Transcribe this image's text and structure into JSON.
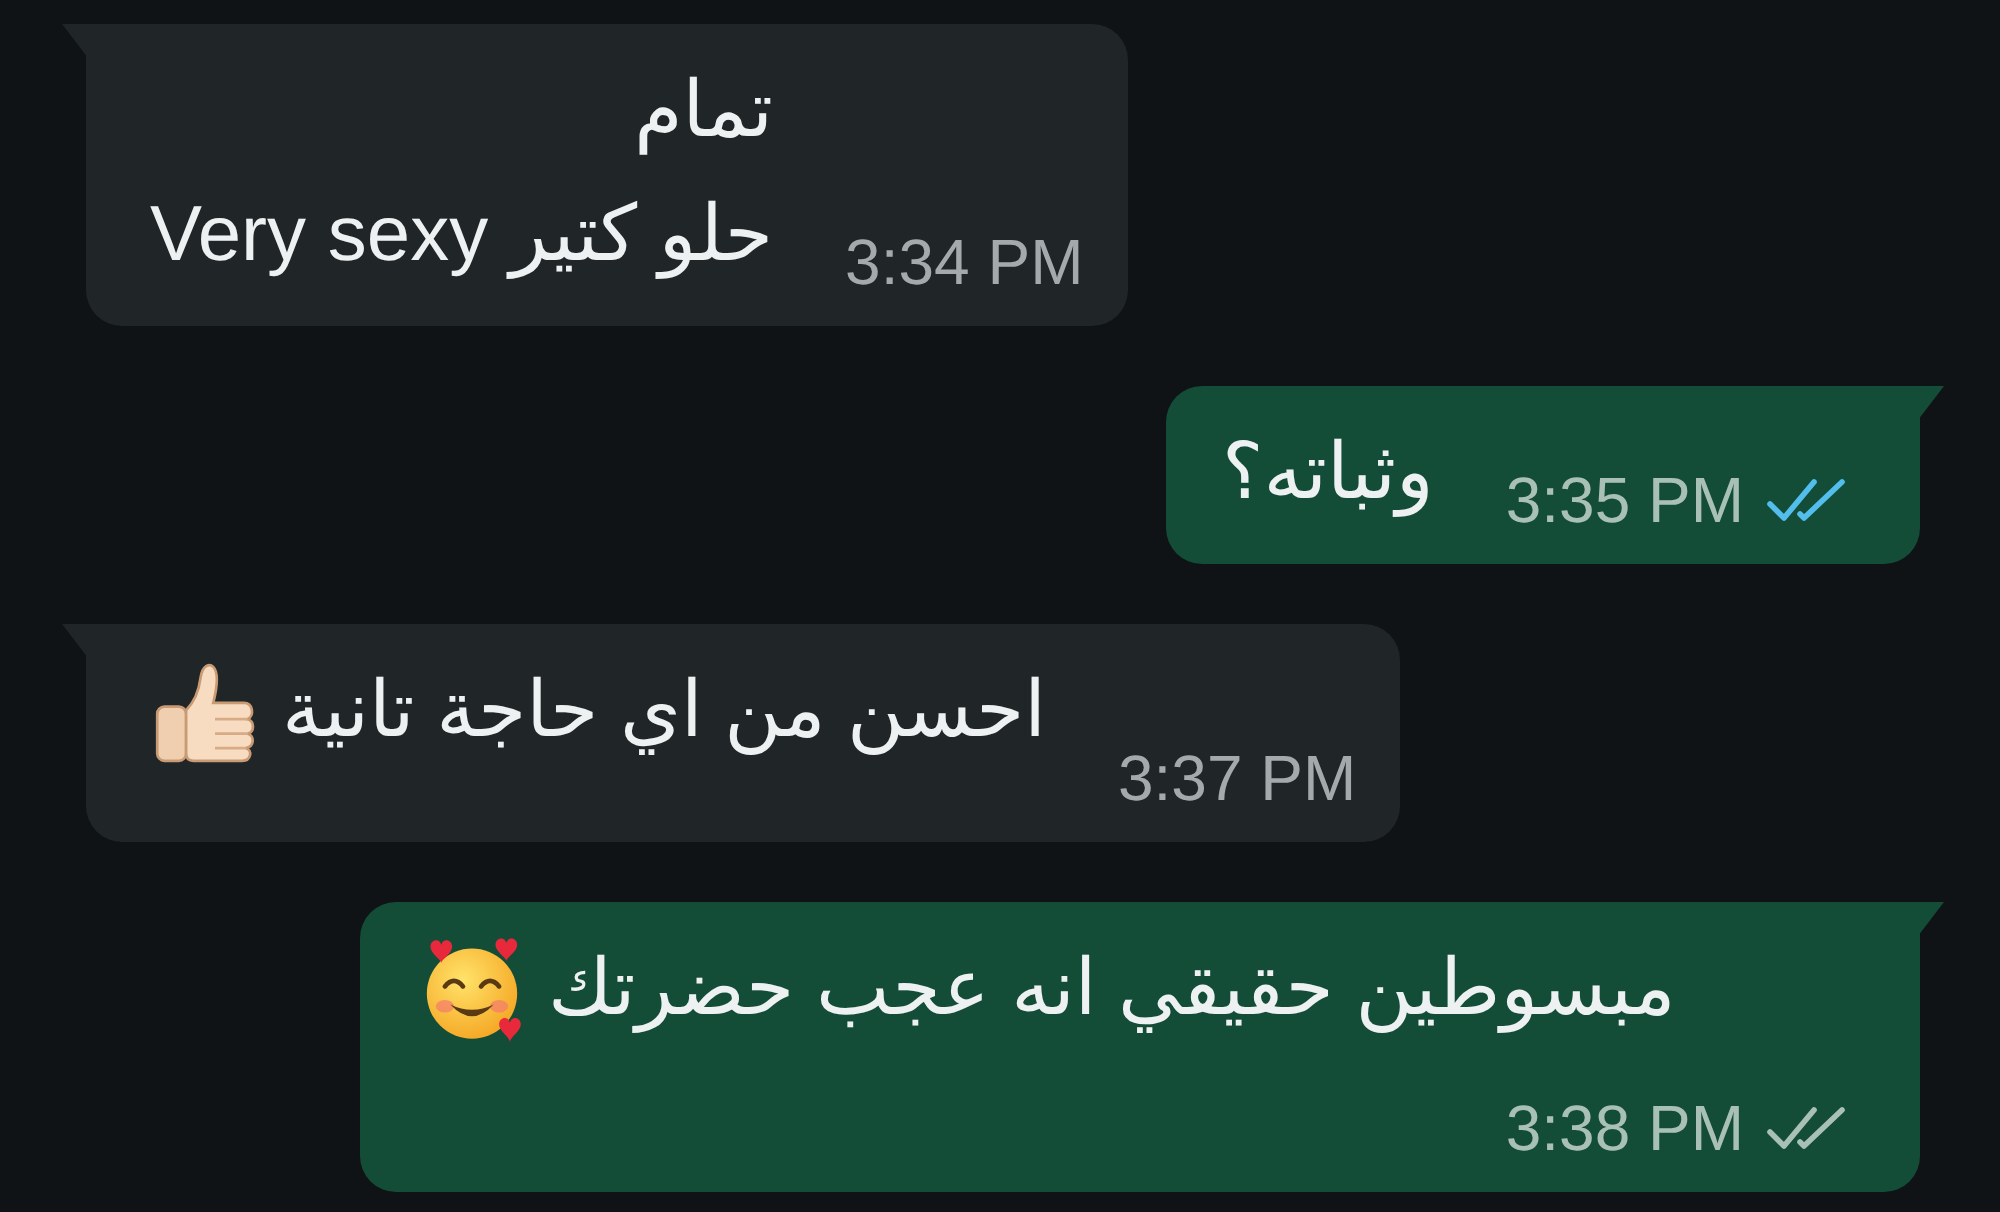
{
  "messages": [
    {
      "kind": "incoming",
      "text": "تمام\nحلو كتير Very sexy",
      "time": "3:34 PM"
    },
    {
      "kind": "outgoing",
      "text": "وثباته؟",
      "time": "3:35 PM",
      "read": true
    },
    {
      "kind": "incoming",
      "text": "احسن من اي حاجة تانية",
      "emoji": {
        "kind": "thumbs_up"
      },
      "time": "3:37 PM"
    },
    {
      "kind": "outgoing",
      "text": "مبسوطين حقيقي انه عجب حضرتك",
      "emoji": {
        "kind": "smiling_face_hearts"
      },
      "time": "3:38 PM",
      "read": false
    }
  ]
}
